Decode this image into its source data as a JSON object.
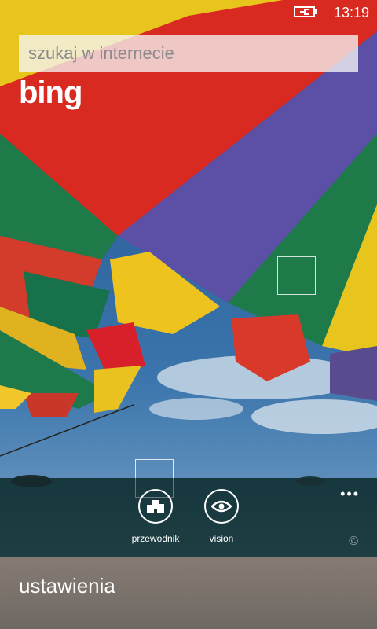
{
  "status_bar": {
    "time": "13:19",
    "battery_icon": "battery-charging-icon"
  },
  "search": {
    "placeholder": "szukaj w internecie"
  },
  "brand": {
    "logo_text": "bing"
  },
  "app_bar": {
    "buttons": [
      {
        "label": "przewodnik",
        "icon": "local-scout-icon"
      },
      {
        "label": "vision",
        "icon": "eye-icon"
      }
    ],
    "more": "•••",
    "copyright": "©"
  },
  "bottom": {
    "settings_label": "ustawienia"
  },
  "colors": {
    "accent": "#ffffff",
    "sky": "#2a5d8f",
    "sea": "#1d4f55"
  }
}
